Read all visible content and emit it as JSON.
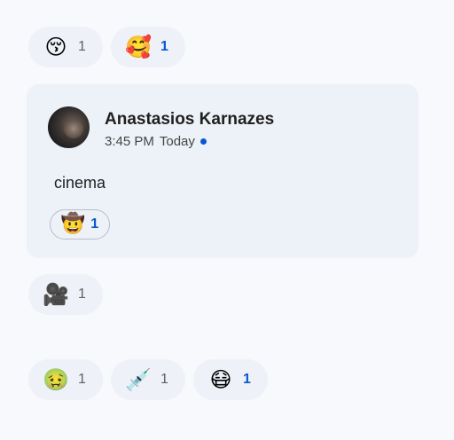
{
  "top_reactions": [
    {
      "emoji": "😚",
      "count": "1",
      "mine": false
    },
    {
      "emoji": "🥰",
      "count": "1",
      "mine": true
    }
  ],
  "message": {
    "author": "Anastasios Karnazes",
    "time": "3:45 PM",
    "day": "Today",
    "text": "cinema",
    "reaction": {
      "emoji": "🤠",
      "count": "1"
    }
  },
  "middle_reactions": [
    {
      "emoji": "🎥",
      "count": "1",
      "mine": false
    }
  ],
  "bottom_reactions": [
    {
      "emoji": "🤢",
      "count": "1",
      "mine": false
    },
    {
      "emoji": "💉",
      "count": "1",
      "mine": false
    },
    {
      "emoji": "😷",
      "count": "1",
      "mine": true
    }
  ],
  "colors": {
    "accent": "#0b57d0",
    "card": "#edf1f8",
    "chip": "#eef1f7"
  }
}
